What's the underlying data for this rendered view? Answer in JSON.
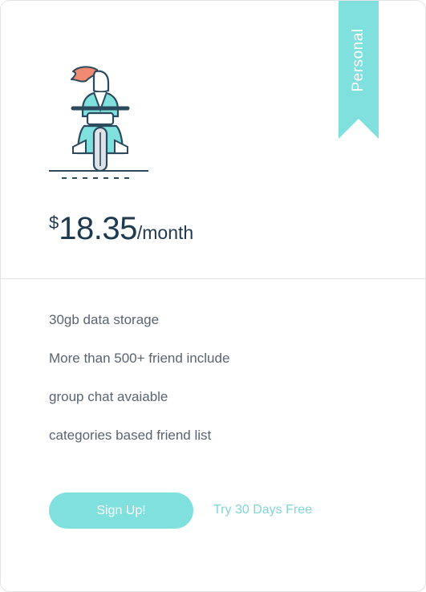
{
  "plan": {
    "badge": "Personal",
    "currency": "$",
    "amount": "18.35",
    "period": "/month"
  },
  "features": [
    "30gb data storage",
    "More than 500+ friend include",
    "group chat avaiable",
    "categories based friend list"
  ],
  "actions": {
    "signup_label": "Sign Up!",
    "trial_label": "Try 30 Days Free"
  },
  "colors": {
    "accent": "#7fe0dd",
    "text_dark": "#1f3a4f",
    "text_body": "#5a6470",
    "hair": "#f08a70"
  },
  "icons": {
    "illustration": "scooter-rider-illustration"
  }
}
